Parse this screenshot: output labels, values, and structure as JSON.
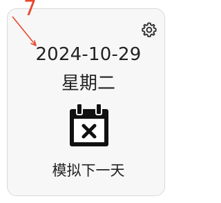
{
  "widget": {
    "date": "2024-10-29",
    "weekday": "星期二",
    "action_label": "模拟下一天",
    "settings_icon": "gear-icon",
    "calendar_icon": "calendar-x-icon"
  },
  "annotation": {
    "number": "7",
    "color": "#e8472d"
  }
}
